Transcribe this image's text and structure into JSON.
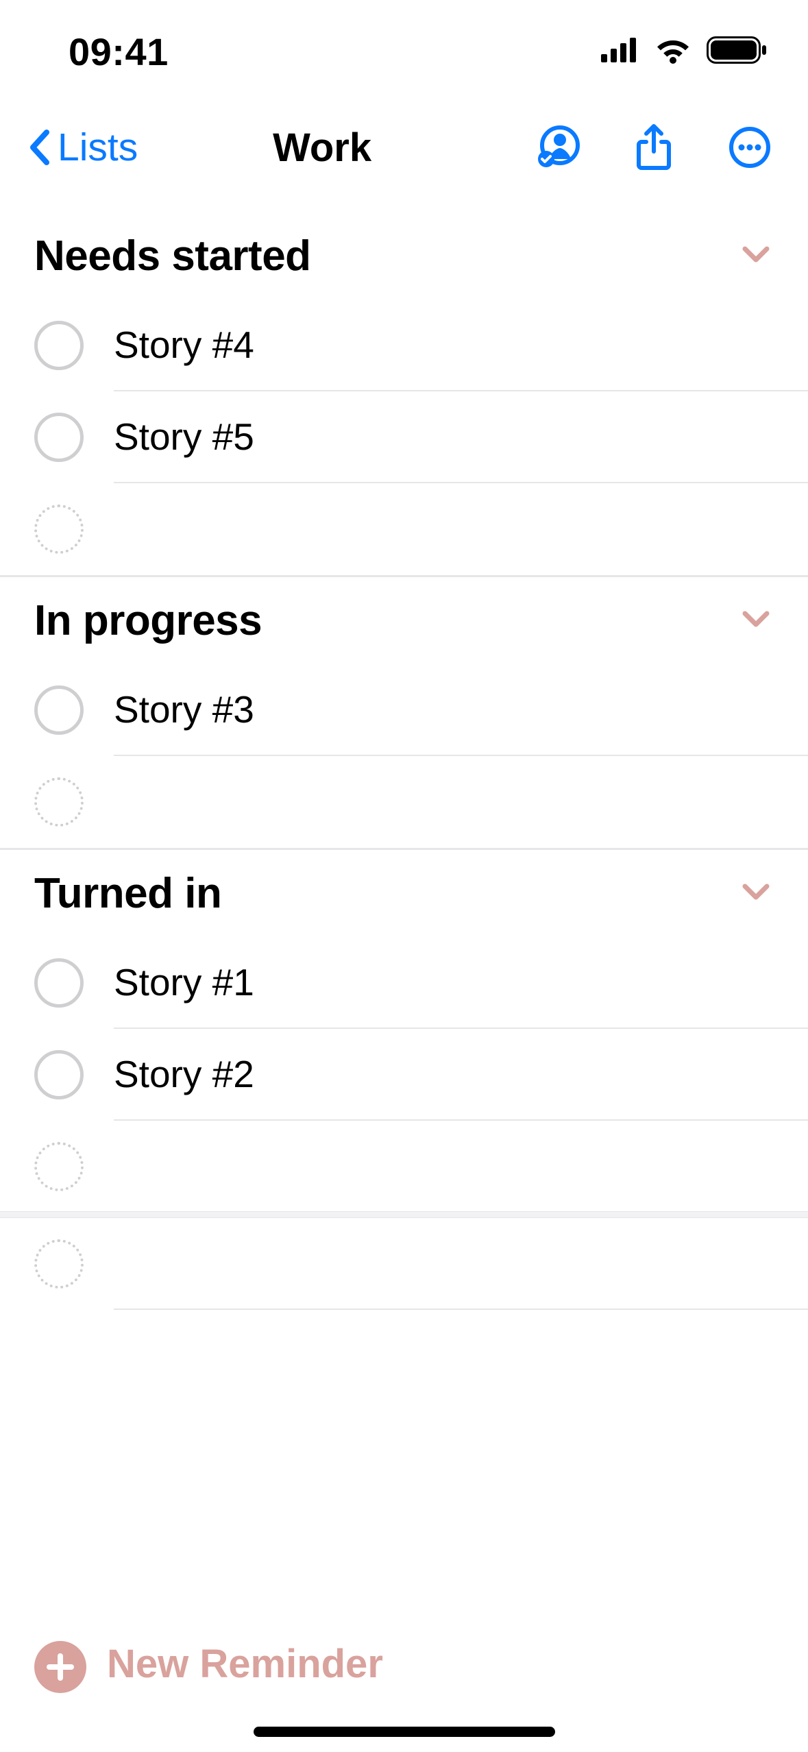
{
  "status": {
    "time": "09:41"
  },
  "nav": {
    "back_label": "Lists",
    "title": "Work"
  },
  "sections": [
    {
      "title": "Needs started",
      "items": [
        "Story #4",
        "Story #5"
      ]
    },
    {
      "title": "In progress",
      "items": [
        "Story #3"
      ]
    },
    {
      "title": "Turned in",
      "items": [
        "Story #1",
        "Story #2"
      ]
    }
  ],
  "bottom": {
    "new_reminder": "New Reminder"
  },
  "colors": {
    "accent_blue": "#0a7aff",
    "accent_tint": "#d9a29d"
  }
}
